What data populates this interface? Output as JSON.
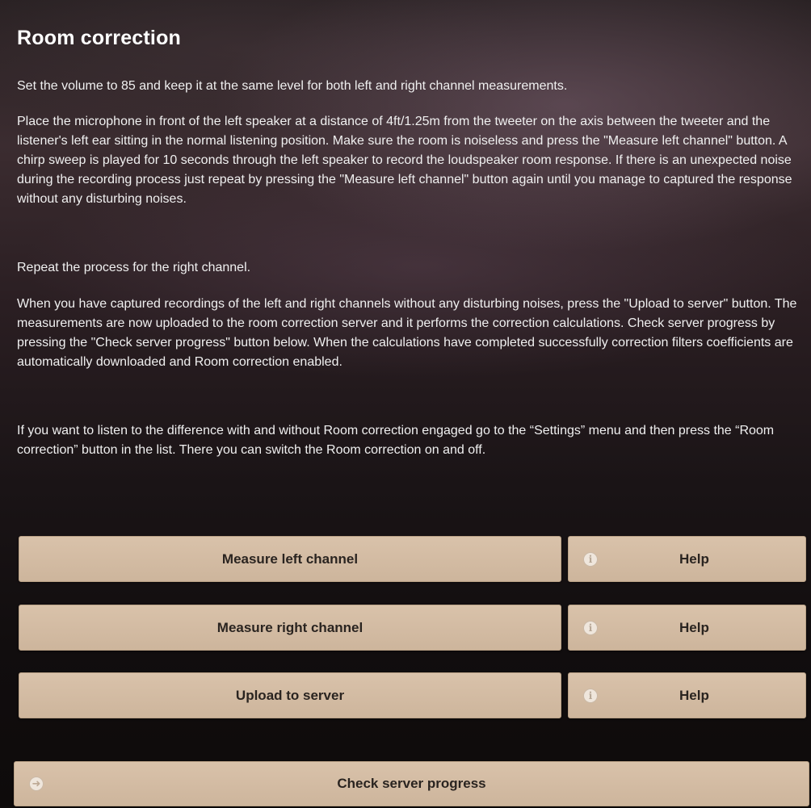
{
  "page": {
    "title": "Room correction",
    "paragraphs": [
      "Set the volume to 85 and keep it at the same level for both left and right channel measurements.",
      "Place the microphone in front of the left speaker at a distance of 4ft/1.25m from the tweeter on the axis between the tweeter and the listener's left ear sitting in the normal listening position. Make sure the room is noiseless and press the \"Measure left channel\" button. A chirp sweep is played for 10 seconds through the left speaker to record the loudspeaker room response. If there is an unexpected noise during the recording process just repeat by pressing the \"Measure left channel\" button again until you manage to captured the response without any disturbing noises.",
      "Repeat the process for the right channel.",
      "When you have captured recordings of the left and right channels without any disturbing noises, press the \"Upload to server\" button. The measurements are now uploaded to the room correction server and it performs the correction calculations. Check server progress by pressing the \"Check server progress\" button below. When the calculations have completed successfully correction filters coefficients are automatically downloaded and Room correction enabled.",
      "If you want to listen to the difference with and without Room correction engaged go to the “Settings” menu and then press the “Room correction” button in the list. There you can switch the Room correction on and off."
    ]
  },
  "buttons": {
    "measure_left": "Measure left channel",
    "measure_right": "Measure right channel",
    "upload": "Upload to server",
    "help": "Help",
    "check_progress": "Check server progress"
  },
  "icons": {
    "info": "info-icon",
    "arrow": "arrow-right-icon"
  },
  "colors": {
    "button_bg": "#d3bba2",
    "button_text": "#2a2420",
    "text": "#f0f0f0"
  }
}
